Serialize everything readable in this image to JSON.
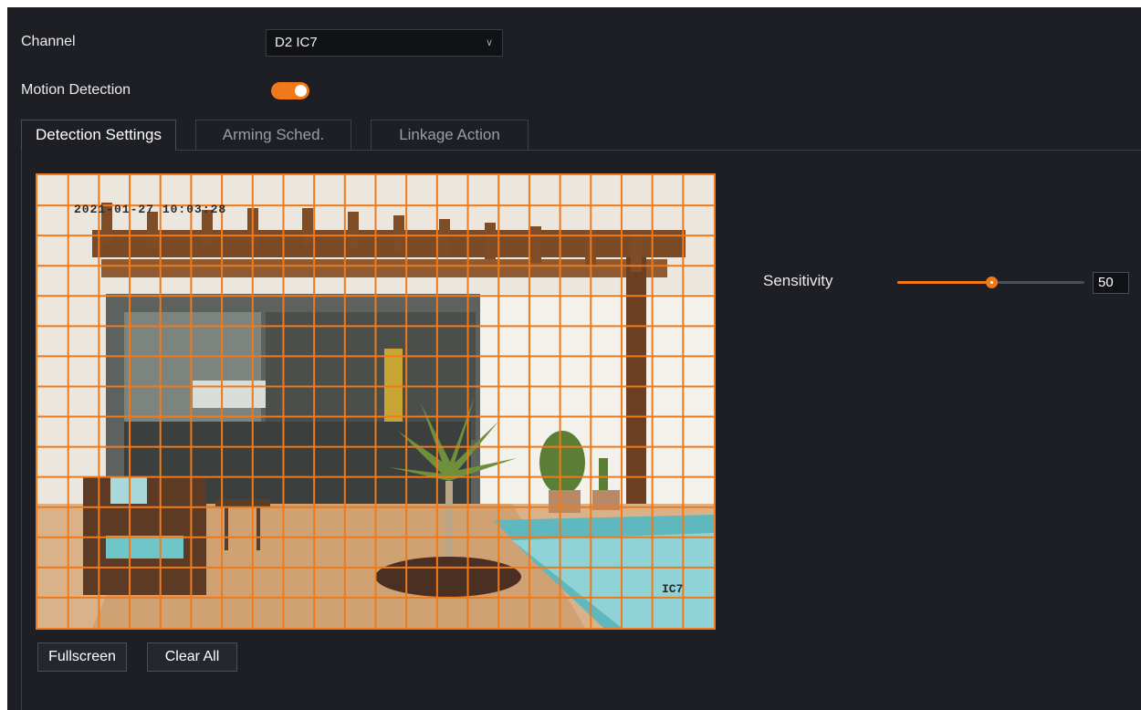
{
  "channel": {
    "label": "Channel",
    "selected": "D2 IC7"
  },
  "motion_detection": {
    "label": "Motion Detection",
    "enabled": true
  },
  "tabs": [
    {
      "label": "Detection Settings",
      "active": true
    },
    {
      "label": "Arming Sched.",
      "active": false
    },
    {
      "label": "Linkage Action",
      "active": false
    }
  ],
  "video": {
    "timestamp": "2021-01-27 10:03:28",
    "camera_name": "IC7",
    "grid": {
      "columns": 22,
      "rows": 15,
      "color": "#f07a1a"
    }
  },
  "sensitivity": {
    "label": "Sensitivity",
    "value": "50",
    "fraction": 0.5
  },
  "buttons": {
    "fullscreen": "Fullscreen",
    "clear_all": "Clear All"
  },
  "colors": {
    "accent": "#f07a1a",
    "background": "#1d1f25"
  }
}
